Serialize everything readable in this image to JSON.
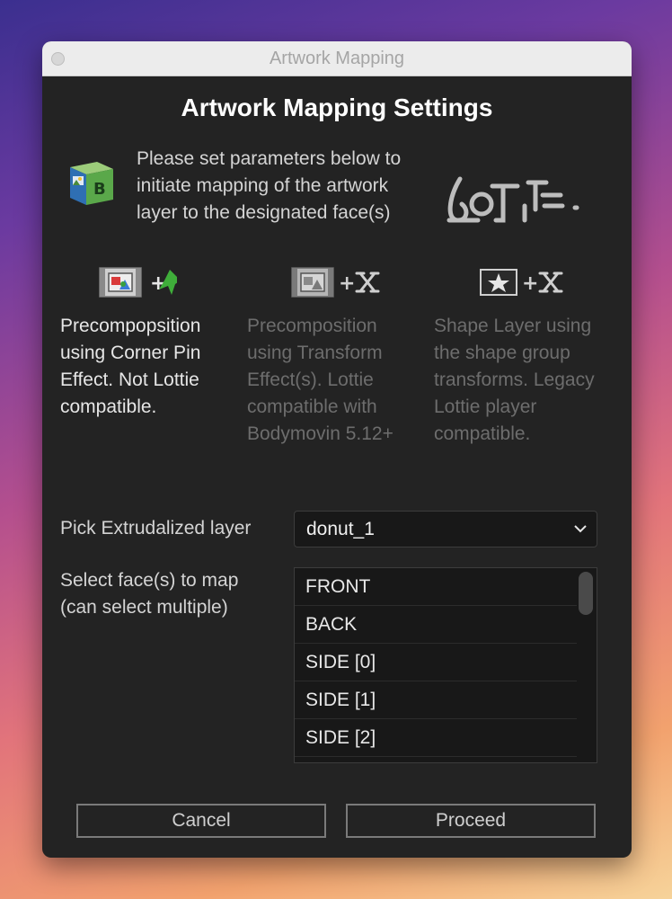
{
  "window": {
    "title": "Artwork Mapping"
  },
  "heading": "Artwork Mapping Settings",
  "intro": {
    "line1": "Please set parameters below to",
    "line2": "initiate mapping of the artwork",
    "line3": "layer to the designated face(s)",
    "icon": "cube-icon"
  },
  "logo": {
    "text": "LOTTIE",
    "icon": "lottie-logo"
  },
  "options": [
    {
      "icons": [
        "precomp-icon",
        "plus",
        "pin-icon"
      ],
      "lines": [
        "Precompopsition",
        "using Corner Pin",
        "Effect. Not Lottie",
        "compatible."
      ],
      "active": true
    },
    {
      "icons": [
        "precomp-icon",
        "plus",
        "transform-icon"
      ],
      "lines": [
        "Precomposition",
        "using Transform",
        "Effect(s). Lottie",
        "compatible with",
        "Bodymovin 5.12+"
      ],
      "active": false
    },
    {
      "icons": [
        "shape-star-icon",
        "plus",
        "transform-icon"
      ],
      "lines": [
        "Shape Layer using",
        "the shape group",
        "transforms. Legacy",
        "Lottie player",
        "compatible."
      ],
      "active": false
    }
  ],
  "layer_picker": {
    "label": "Pick Extrudalized layer",
    "value": "donut_1"
  },
  "faces": {
    "label_line1": "Select face(s) to map",
    "label_line2": "(can select multiple)",
    "items": [
      "FRONT",
      "BACK",
      "SIDE  [0]",
      "SIDE  [1]",
      "SIDE  [2]"
    ]
  },
  "buttons": {
    "cancel": "Cancel",
    "proceed": "Proceed"
  },
  "colors": {
    "window_bg": "#232323",
    "text_active": "#e6e6e6",
    "text_disabled": "#6d6d6d",
    "accent_pin": "#3fae3a"
  }
}
